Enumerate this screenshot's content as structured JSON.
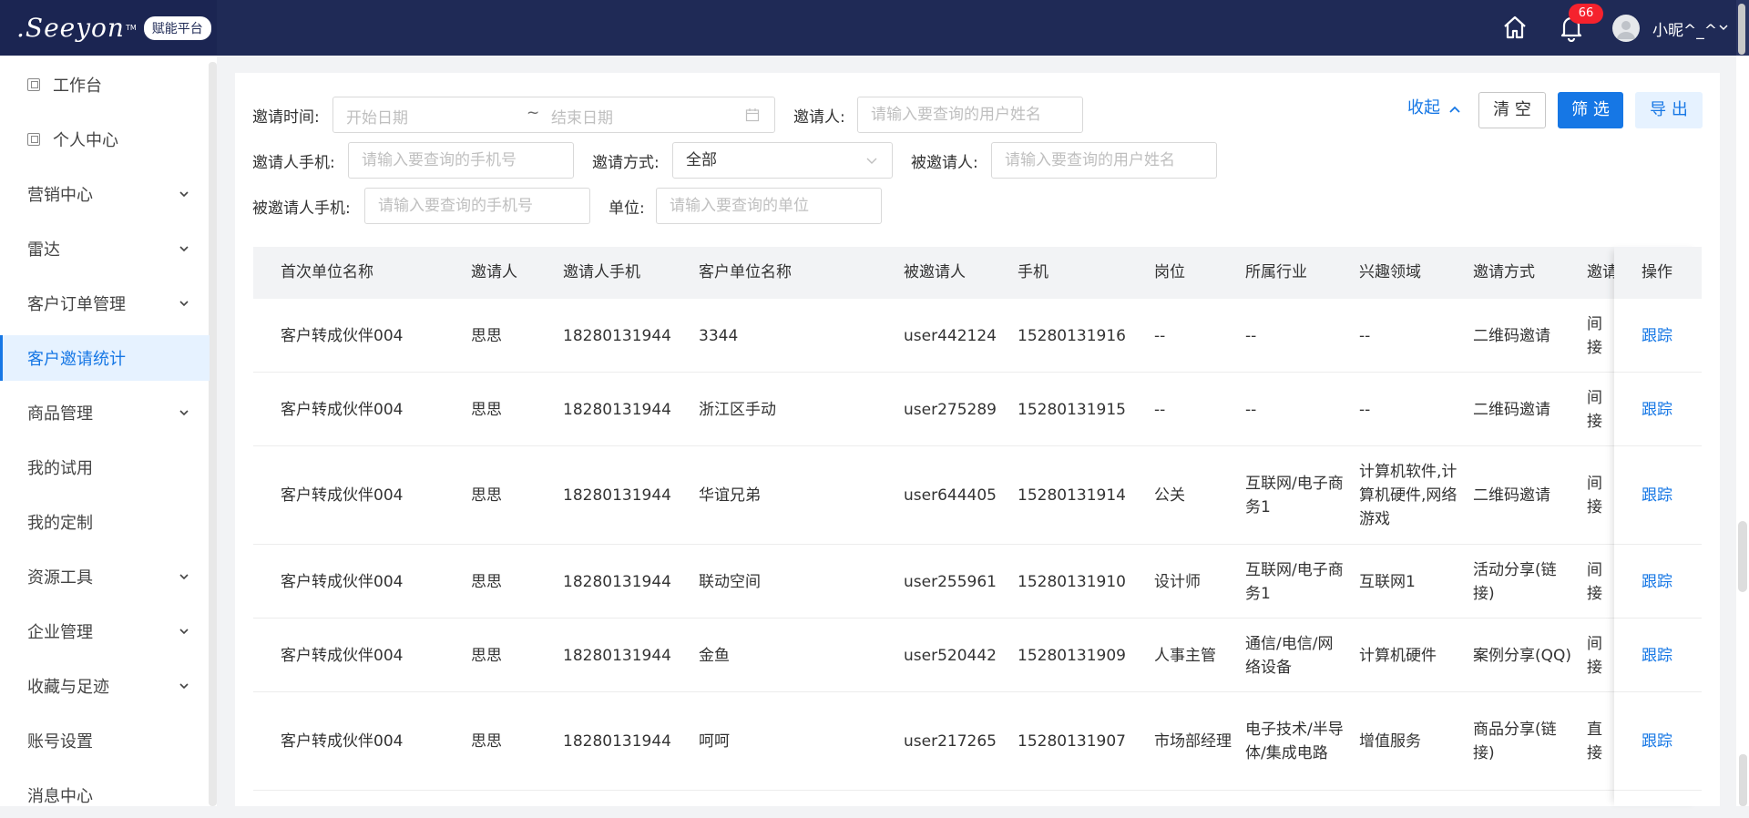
{
  "header": {
    "logo_text": ".Seeyon",
    "logo_tm": "TM",
    "platform_badge": "赋能平台",
    "notification_count": "66",
    "username": "小昵^_^"
  },
  "sidebar": {
    "items": [
      {
        "label": "工作台"
      },
      {
        "label": "个人中心"
      },
      {
        "label": "营销中心"
      },
      {
        "label": "雷达"
      },
      {
        "label": "客户订单管理"
      },
      {
        "label": "客户邀请统计"
      },
      {
        "label": "商品管理"
      },
      {
        "label": "我的试用"
      },
      {
        "label": "我的定制"
      },
      {
        "label": "资源工具"
      },
      {
        "label": "企业管理"
      },
      {
        "label": "收藏与足迹"
      },
      {
        "label": "账号设置"
      },
      {
        "label": "消息中心"
      }
    ]
  },
  "filters": {
    "invite_time_label": "邀请时间:",
    "start_date_placeholder": "开始日期",
    "tilde": "~",
    "end_date_placeholder": "结束日期",
    "inviter_label": "邀请人:",
    "inviter_placeholder": "请输入要查询的用户姓名",
    "inviter_phone_label": "邀请人手机:",
    "inviter_phone_placeholder": "请输入要查询的手机号",
    "invite_method_label": "邀请方式:",
    "invite_method_value": "全部",
    "invitee_label": "被邀请人:",
    "invitee_placeholder": "请输入要查询的用户姓名",
    "invitee_phone_label": "被邀请人手机:",
    "invitee_phone_placeholder": "请输入要查询的手机号",
    "unit_label": "单位:",
    "unit_placeholder": "请输入要查询的单位",
    "collapse_label": "收起",
    "clear_label": "清 空",
    "filter_label": "筛 选",
    "export_label": "导 出"
  },
  "table": {
    "columns": [
      "首次单位名称",
      "邀请人",
      "邀请人手机",
      "客户单位名称",
      "被邀请人",
      "手机",
      "岗位",
      "所属行业",
      "兴趣领域",
      "邀请方式",
      "邀请",
      "操作"
    ],
    "rows": [
      {
        "first_unit": "客户转成伙伴004",
        "inviter": "思思",
        "inviter_phone": "18280131944",
        "customer_unit": "3344",
        "invitee": "user442124",
        "phone": "15280131916",
        "position": "--",
        "industry": "--",
        "interest": "--",
        "method": "二维码邀请",
        "type": "间接",
        "action": "跟踪"
      },
      {
        "first_unit": "客户转成伙伴004",
        "inviter": "思思",
        "inviter_phone": "18280131944",
        "customer_unit": "浙江区手动",
        "invitee": "user275289",
        "phone": "15280131915",
        "position": "--",
        "industry": "--",
        "interest": "--",
        "method": "二维码邀请",
        "type": "间接",
        "action": "跟踪"
      },
      {
        "first_unit": "客户转成伙伴004",
        "inviter": "思思",
        "inviter_phone": "18280131944",
        "customer_unit": "华谊兄弟",
        "invitee": "user644405",
        "phone": "15280131914",
        "position": "公关",
        "industry": "互联网/电子商务1",
        "interest": "计算机软件,计算机硬件,网络游戏",
        "method": "二维码邀请",
        "type": "间接",
        "action": "跟踪"
      },
      {
        "first_unit": "客户转成伙伴004",
        "inviter": "思思",
        "inviter_phone": "18280131944",
        "customer_unit": "联动空间",
        "invitee": "user255961",
        "phone": "15280131910",
        "position": "设计师",
        "industry": "互联网/电子商务1",
        "interest": "互联网1",
        "method": "活动分享(链接)",
        "type": "间接",
        "action": "跟踪"
      },
      {
        "first_unit": "客户转成伙伴004",
        "inviter": "思思",
        "inviter_phone": "18280131944",
        "customer_unit": "金鱼",
        "invitee": "user520442",
        "phone": "15280131909",
        "position": "人事主管",
        "industry": "通信/电信/网络设备",
        "interest": "计算机硬件",
        "method": "案例分享(QQ)",
        "type": "间接",
        "action": "跟踪"
      },
      {
        "first_unit": "客户转成伙伴004",
        "inviter": "思思",
        "inviter_phone": "18280131944",
        "customer_unit": "呵呵",
        "invitee": "user217265",
        "phone": "15280131907",
        "position": "市场部经理",
        "industry": "电子技术/半导体/集成电路",
        "interest": "增值服务",
        "method": "商品分享(链接)",
        "type": "直接",
        "action": "跟踪"
      }
    ]
  },
  "colors": {
    "header_bg": "#1f2a56",
    "accent": "#1677e5",
    "badge_red": "#f5222d"
  }
}
